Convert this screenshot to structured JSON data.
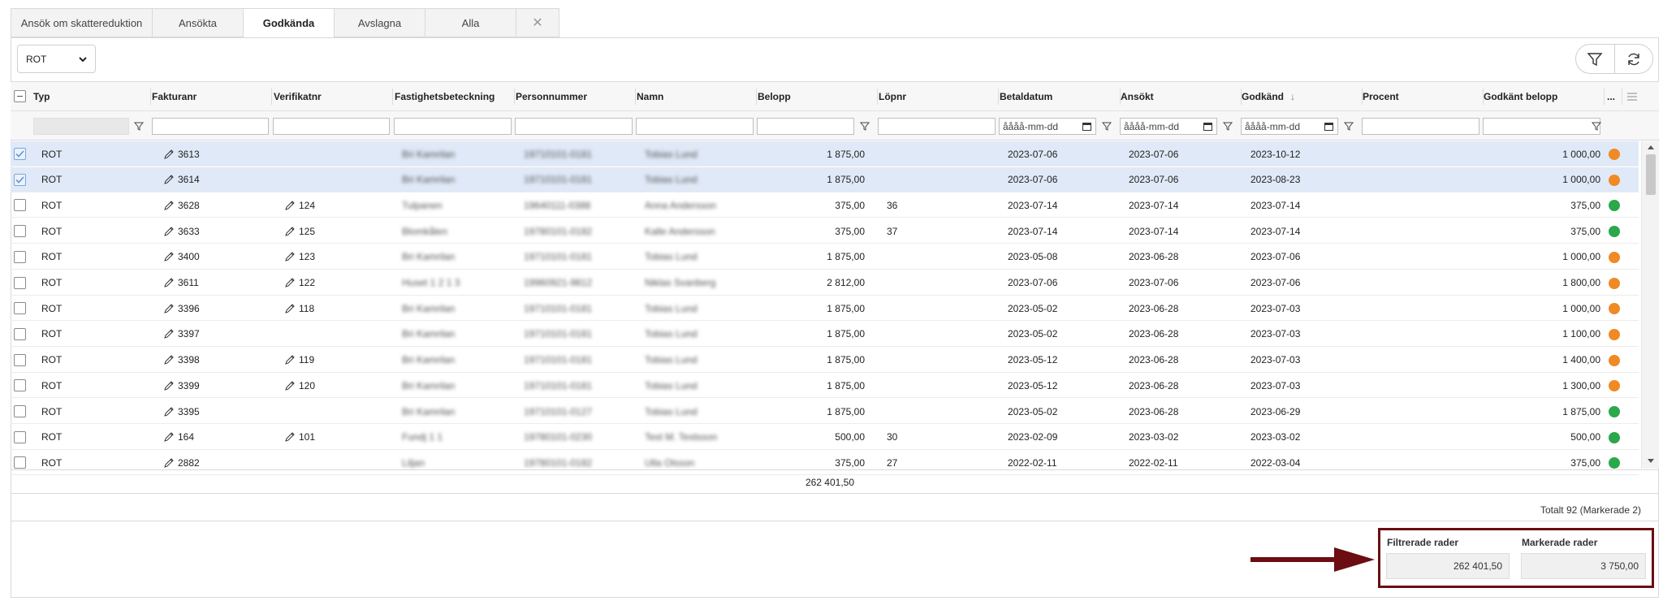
{
  "tabs": [
    "Ansök om skattereduktion",
    "Ansökta",
    "Godkända",
    "Avslagna",
    "Alla"
  ],
  "type_select": "ROT",
  "columns": [
    "Typ",
    "Fakturanr",
    "Verifikatnr",
    "Fastighetsbeteckning",
    "Personnummer",
    "Namn",
    "Belopp",
    "Löpnr",
    "Betaldatum",
    "Ansökt",
    "Godkänd",
    "Procent",
    "Godkänt belopp",
    "..."
  ],
  "sort_indicator": "↓",
  "date_placeholder": "åååå-mm-dd",
  "rows": [
    {
      "typ": "ROT",
      "faktura": "3613",
      "verifikat": "",
      "fastighet": "Bri Kamrilan",
      "personnr": "19710101-0181",
      "namn": "Tobias Lund",
      "belopp": "1 875,00",
      "lopnr": "",
      "betald": "2023-07-06",
      "ansokt": "2023-07-06",
      "godkand": "2023-10-12",
      "procent": "",
      "godkant": "1 000,00",
      "status": "orange",
      "selected": true
    },
    {
      "typ": "ROT",
      "faktura": "3614",
      "verifikat": "",
      "fastighet": "Bri Kamrilan",
      "personnr": "19710101-0181",
      "namn": "Tobias Lund",
      "belopp": "1 875,00",
      "lopnr": "",
      "betald": "2023-07-06",
      "ansokt": "2023-07-06",
      "godkand": "2023-08-23",
      "procent": "",
      "godkant": "1 000,00",
      "status": "orange",
      "selected": true
    },
    {
      "typ": "ROT",
      "faktura": "3628",
      "verifikat": "124",
      "fastighet": "Tulpanen",
      "personnr": "19640111-0388",
      "namn": "Anna Andersson",
      "belopp": "375,00",
      "lopnr": "36",
      "betald": "2023-07-14",
      "ansokt": "2023-07-14",
      "godkand": "2023-07-14",
      "procent": "",
      "godkant": "375,00",
      "status": "green",
      "selected": false
    },
    {
      "typ": "ROT",
      "faktura": "3633",
      "verifikat": "125",
      "fastighet": "Blomkålen",
      "personnr": "19780101-0182",
      "namn": "Kalle Andersson",
      "belopp": "375,00",
      "lopnr": "37",
      "betald": "2023-07-14",
      "ansokt": "2023-07-14",
      "godkand": "2023-07-14",
      "procent": "",
      "godkant": "375,00",
      "status": "green",
      "selected": false
    },
    {
      "typ": "ROT",
      "faktura": "3400",
      "verifikat": "123",
      "fastighet": "Bri Kamrilan",
      "personnr": "19710101-0181",
      "namn": "Tobias Lund",
      "belopp": "1 875,00",
      "lopnr": "",
      "betald": "2023-05-08",
      "ansokt": "2023-06-28",
      "godkand": "2023-07-06",
      "procent": "",
      "godkant": "1 000,00",
      "status": "orange",
      "selected": false
    },
    {
      "typ": "ROT",
      "faktura": "3611",
      "verifikat": "122",
      "fastighet": "Huset 1 2 1 3",
      "personnr": "19960921-9812",
      "namn": "Niklas Svanberg",
      "belopp": "2 812,00",
      "lopnr": "",
      "betald": "2023-07-06",
      "ansokt": "2023-07-06",
      "godkand": "2023-07-06",
      "procent": "",
      "godkant": "1 800,00",
      "status": "orange",
      "selected": false
    },
    {
      "typ": "ROT",
      "faktura": "3396",
      "verifikat": "118",
      "fastighet": "Bri Kamrilan",
      "personnr": "19710101-0181",
      "namn": "Tobias Lund",
      "belopp": "1 875,00",
      "lopnr": "",
      "betald": "2023-05-02",
      "ansokt": "2023-06-28",
      "godkand": "2023-07-03",
      "procent": "",
      "godkant": "1 000,00",
      "status": "orange",
      "selected": false
    },
    {
      "typ": "ROT",
      "faktura": "3397",
      "verifikat": "",
      "fastighet": "Bri Kamrilan",
      "personnr": "19710101-0181",
      "namn": "Tobias Lund",
      "belopp": "1 875,00",
      "lopnr": "",
      "betald": "2023-05-02",
      "ansokt": "2023-06-28",
      "godkand": "2023-07-03",
      "procent": "",
      "godkant": "1 100,00",
      "status": "orange",
      "selected": false
    },
    {
      "typ": "ROT",
      "faktura": "3398",
      "verifikat": "119",
      "fastighet": "Bri Kamrilan",
      "personnr": "19710101-0181",
      "namn": "Tobias Lund",
      "belopp": "1 875,00",
      "lopnr": "",
      "betald": "2023-05-12",
      "ansokt": "2023-06-28",
      "godkand": "2023-07-03",
      "procent": "",
      "godkant": "1 400,00",
      "status": "orange",
      "selected": false
    },
    {
      "typ": "ROT",
      "faktura": "3399",
      "verifikat": "120",
      "fastighet": "Bri Kamrilan",
      "personnr": "19710101-0181",
      "namn": "Tobias Lund",
      "belopp": "1 875,00",
      "lopnr": "",
      "betald": "2023-05-12",
      "ansokt": "2023-06-28",
      "godkand": "2023-07-03",
      "procent": "",
      "godkant": "1 300,00",
      "status": "orange",
      "selected": false
    },
    {
      "typ": "ROT",
      "faktura": "3395",
      "verifikat": "",
      "fastighet": "Bri Kamrilan",
      "personnr": "19710101-0127",
      "namn": "Tobias Lund",
      "belopp": "1 875,00",
      "lopnr": "",
      "betald": "2023-05-02",
      "ansokt": "2023-06-28",
      "godkand": "2023-06-29",
      "procent": "",
      "godkant": "1 875,00",
      "status": "green",
      "selected": false
    },
    {
      "typ": "ROT",
      "faktura": "164",
      "verifikat": "101",
      "fastighet": "Fundj 1 1",
      "personnr": "19780101-0230",
      "namn": "Test M. Testsson",
      "belopp": "500,00",
      "lopnr": "30",
      "betald": "2023-02-09",
      "ansokt": "2023-03-02",
      "godkand": "2023-03-02",
      "procent": "",
      "godkant": "500,00",
      "status": "green",
      "selected": false
    },
    {
      "typ": "ROT",
      "faktura": "2882",
      "verifikat": "",
      "fastighet": "Liljan",
      "personnr": "19780101-0182",
      "namn": "Ulla Olsson",
      "belopp": "375,00",
      "lopnr": "27",
      "betald": "2022-02-11",
      "ansokt": "2022-02-11",
      "godkand": "2022-03-04",
      "procent": "",
      "godkant": "375,00",
      "status": "green",
      "selected": false
    }
  ],
  "sum_belopp": "262 401,50",
  "footer_totals": "Totalt 92   (Markerade 2)",
  "summary": {
    "filtered_label": "Filtrerade rader",
    "filtered_value": "262 401,50",
    "marked_label": "Markerade rader",
    "marked_value": "3 750,00"
  },
  "colors": {
    "orange": "#f08a24",
    "green": "#2aa84a",
    "accent_arrow": "#6b0d12",
    "selected_row": "#dfe9f7"
  }
}
